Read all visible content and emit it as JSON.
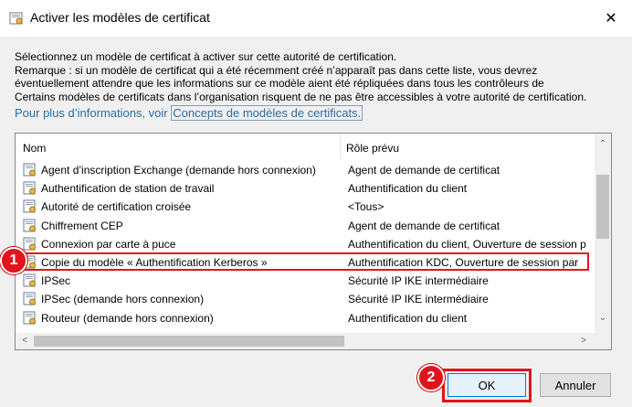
{
  "window": {
    "title": "Activer les modèles de certificat",
    "close_glyph": "✕"
  },
  "description": {
    "line1": "Sélectionnez un modèle de certificat à activer sur cette autorité de certification.",
    "line2": "Remarque : si un modèle de certificat qui a été récemment créé n’apparaît pas dans cette liste, vous devrez",
    "line3": "éventuellement attendre que les informations sur ce modèle aient été répliquées dans tous les contrôleurs de",
    "line4": "Certains modèles de certificats dans l’organisation risquent de ne pas être accessibles à votre autorité de certification.",
    "more_info_prefix": "Pour plus d’informations, voir ",
    "more_info_link": "Concepts de modèles de certificats."
  },
  "list": {
    "columns": {
      "name": "Nom",
      "role": "Rôle prévu"
    },
    "rows": [
      {
        "name": "Agent d’inscription Exchange (demande hors connexion)",
        "role": "Agent de demande de certificat"
      },
      {
        "name": "Authentification de station de travail",
        "role": "Authentification du client"
      },
      {
        "name": "Autorité de certification croisée",
        "role": "<Tous>"
      },
      {
        "name": "Chiffrement CEP",
        "role": "Agent de demande de certificat"
      },
      {
        "name": "Connexion par carte à puce",
        "role": "Authentification du client, Ouverture de session p"
      },
      {
        "name": "Copie du modèle « Authentification Kerberos »",
        "role": "Authentification KDC, Ouverture de session par"
      },
      {
        "name": "IPSec",
        "role": "Sécurité IP IKE intermédiaire"
      },
      {
        "name": "IPSec (demande hors connexion)",
        "role": "Sécurité IP IKE intermédiaire"
      },
      {
        "name": "Routeur (demande hors connexion)",
        "role": "Authentification du client"
      }
    ],
    "selected_index": 5,
    "scroll": {
      "up": "⌃",
      "down": "⌄",
      "left": "<",
      "right": ">"
    }
  },
  "annotations": {
    "badge1": "1",
    "badge2": "2",
    "accent_color": "#e0141e"
  },
  "buttons": {
    "ok": "OK",
    "cancel": "Annuler"
  }
}
